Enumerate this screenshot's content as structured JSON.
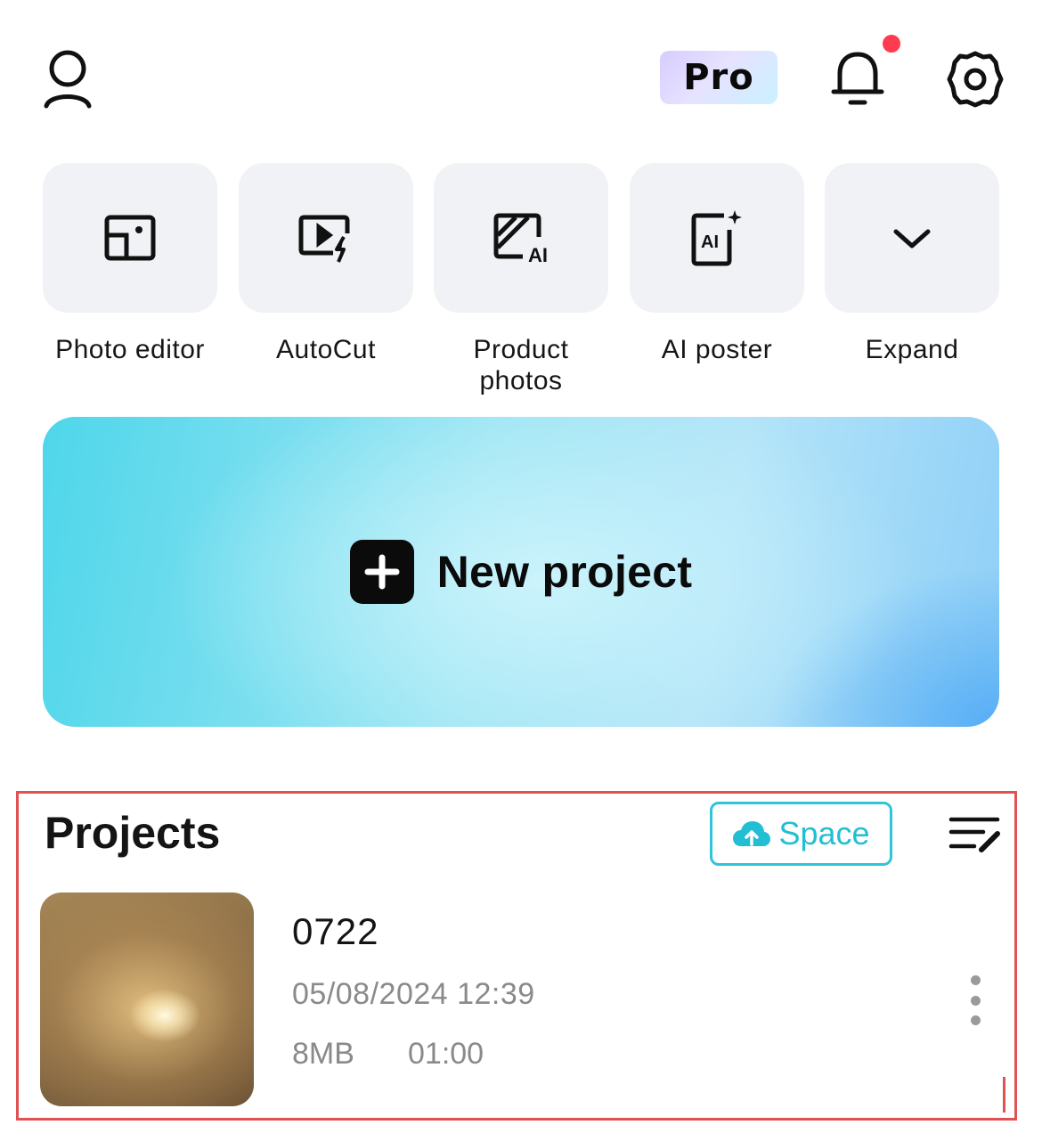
{
  "header": {
    "profile_icon": "user-icon",
    "pro_label": "Pro",
    "notifications_icon": "bell-icon",
    "has_unread_notifications": true,
    "settings_icon": "gear-icon"
  },
  "tools": [
    {
      "label": "Photo editor",
      "icon": "photo-edit-icon"
    },
    {
      "label": "AutoCut",
      "icon": "autocut-icon"
    },
    {
      "label": "Product photos",
      "icon": "ai-image-icon"
    },
    {
      "label": "AI poster",
      "icon": "ai-poster-icon"
    },
    {
      "label": "Expand",
      "icon": "chevron-down-icon"
    }
  ],
  "new_project": {
    "label": "New project",
    "icon": "plus-icon"
  },
  "projects": {
    "title": "Projects",
    "space_label": "Space",
    "space_icon": "cloud-upload-icon",
    "manage_icon": "edit-list-icon",
    "items": [
      {
        "name": "0722",
        "date": "05/08/2024 12:39",
        "size": "8MB",
        "duration": "01:00"
      }
    ]
  },
  "colors": {
    "accent": "#22bfd4",
    "notification_dot": "#ff3b4f",
    "tile_bg": "#f0f2f5",
    "highlight_frame": "#e05252"
  }
}
